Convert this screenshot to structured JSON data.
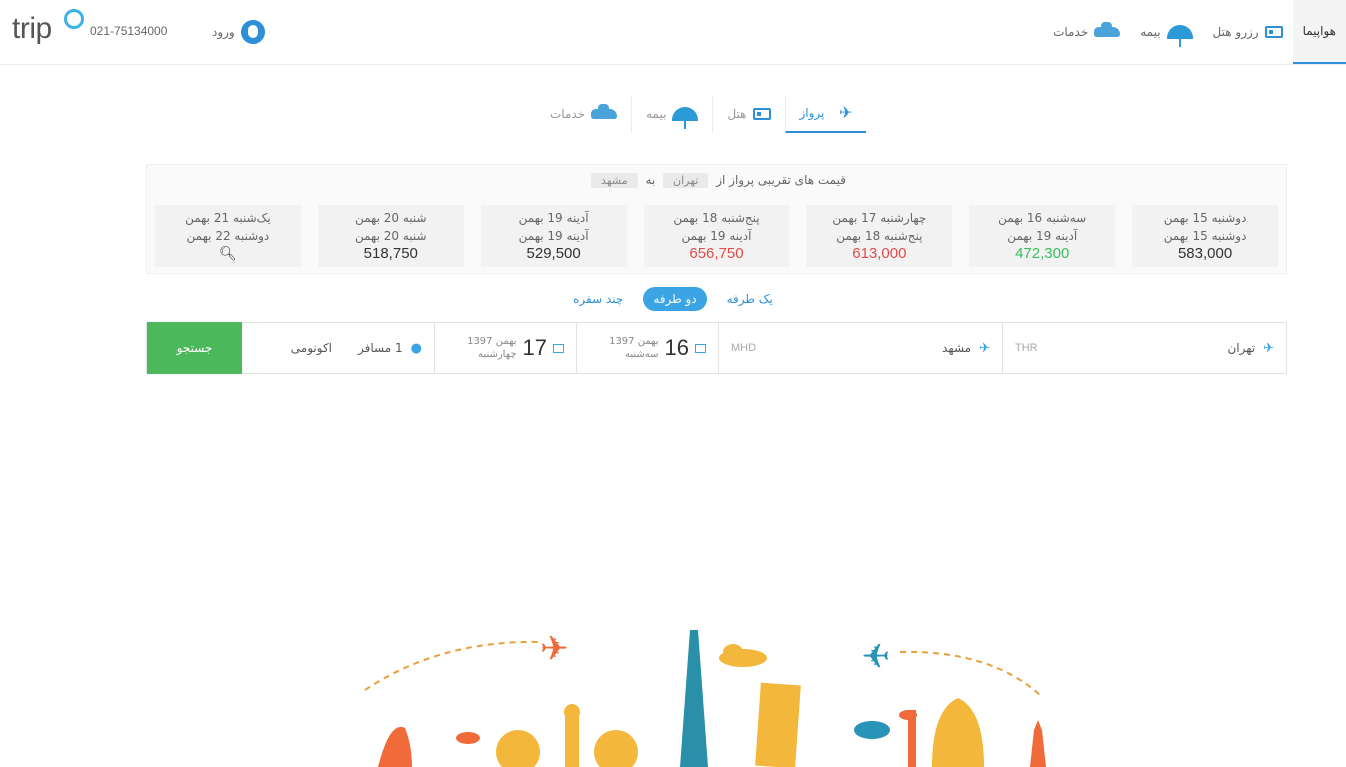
{
  "header": {
    "logo": "trip",
    "phone": "021-75134000",
    "login_label": "ورود",
    "nav": [
      {
        "label": "هواپیما",
        "icon": "plane-icon",
        "active": true
      },
      {
        "label": "رزرو هتل",
        "icon": "hotel-icon"
      },
      {
        "label": "بیمه",
        "icon": "umbrella-icon"
      },
      {
        "label": "خدمات",
        "icon": "car-icon"
      }
    ]
  },
  "tabs": [
    {
      "label": "پرواز",
      "icon": "plane-icon",
      "active": true
    },
    {
      "label": "هتل",
      "icon": "hotel-icon"
    },
    {
      "label": "بیمه",
      "icon": "umbrella-icon"
    },
    {
      "label": "خدمات",
      "icon": "car-icon"
    }
  ],
  "prices": {
    "title": "قیمت های تقریبی پرواز از",
    "from": "تهران",
    "to_word": "به",
    "to": "مشهد",
    "cells": [
      {
        "depart": "دوشنبه 15 بهمن",
        "return": "دوشنبه 15 بهمن",
        "price": "583,000",
        "tone": "normal"
      },
      {
        "depart": "سه‌شنبه 16 بهمن",
        "return": "آدینه 19 بهمن",
        "price": "472,300",
        "tone": "green"
      },
      {
        "depart": "چهارشنبه 17 بهمن",
        "return": "پنج‌شنبه 18 بهمن",
        "price": "613,000",
        "tone": "red"
      },
      {
        "depart": "پنج‌شنبه 18 بهمن",
        "return": "آدینه 19 بهمن",
        "price": "656,750",
        "tone": "red"
      },
      {
        "depart": "آدینه 19 بهمن",
        "return": "آدینه 19 بهمن",
        "price": "529,500",
        "tone": "normal"
      },
      {
        "depart": "شنبه 20 بهمن",
        "return": "شنبه 20 بهمن",
        "price": "518,750",
        "tone": "normal"
      },
      {
        "depart": "یک‌شنبه 21 بهمن",
        "return": "دوشنبه 22 بهمن",
        "price": "",
        "tone": "search"
      }
    ]
  },
  "trip_type": {
    "one_way": "یک طرفه",
    "round_trip": "دو طرفه",
    "multi_city": "چند سفره"
  },
  "search": {
    "from_city": "تهران",
    "from_code": "THR",
    "to_city": "مشهد",
    "to_code": "MHD",
    "depart_day": "16",
    "depart_month": "بهمن",
    "depart_year": "1397",
    "depart_weekday": "سه‌شنبه",
    "return_day": "17",
    "return_month": "بهمن",
    "return_year": "1397",
    "return_weekday": "چهارشنبه",
    "passengers": "1 مسافر",
    "cabin": "اکونومی",
    "button": "جستجو"
  },
  "colors": {
    "brand_blue": "#2d8fd8",
    "search_green": "#4cb85c",
    "price_red": "#e14b4b",
    "price_green": "#3bbd5e"
  }
}
